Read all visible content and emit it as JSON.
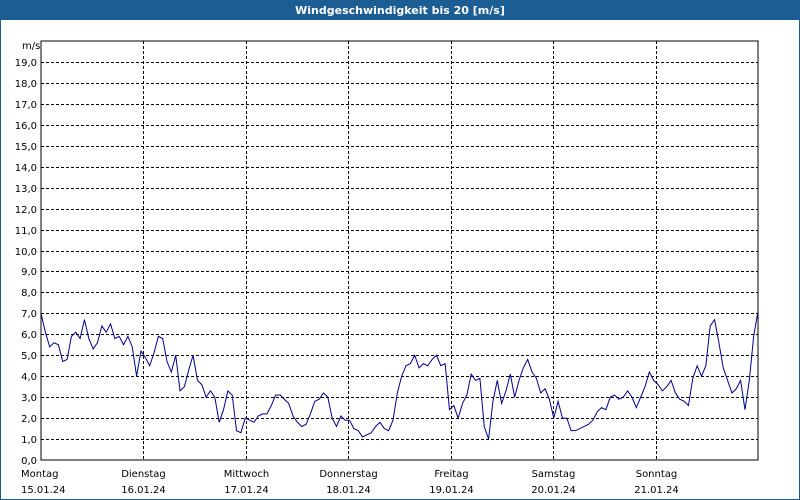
{
  "chart_data": {
    "type": "line",
    "title": "Windgeschwindigkeit bis 20 [m/s]",
    "ylabel": "m/s",
    "ylim": [
      0,
      20
    ],
    "yticks": [
      "0,0",
      "1,0",
      "2,0",
      "3,0",
      "4,0",
      "5,0",
      "6,0",
      "7,0",
      "8,0",
      "9,0",
      "10,0",
      "11,0",
      "12,0",
      "13,0",
      "14,0",
      "15,0",
      "16,0",
      "17,0",
      "18,0",
      "19,0"
    ],
    "grid": true,
    "xticks": [
      {
        "day": "Montag",
        "date": "15.01.24"
      },
      {
        "day": "Dienstag",
        "date": "16.01.24"
      },
      {
        "day": "Mittwoch",
        "date": "17.01.24"
      },
      {
        "day": "Donnerstag",
        "date": "18.01.24"
      },
      {
        "day": "Freitag",
        "date": "19.01.24"
      },
      {
        "day": "Samstag",
        "date": "20.01.24"
      },
      {
        "day": "Sonntag",
        "date": "21.01.24"
      }
    ],
    "line_color": "#00008b",
    "series": [
      {
        "values": [
          7.0,
          6.1,
          5.4,
          5.6,
          5.5,
          4.7,
          4.8,
          5.9,
          6.1,
          5.8,
          6.7,
          5.8,
          5.3,
          5.6,
          6.4,
          6.1,
          6.5,
          5.8,
          5.9,
          5.5,
          5.9,
          5.4,
          4.0,
          5.2,
          4.9,
          4.5,
          5.1,
          5.9,
          5.8,
          4.7,
          4.2,
          5.0,
          3.3,
          3.5,
          4.3,
          5.0,
          3.8,
          3.6,
          3.0,
          3.3,
          3.0,
          1.8,
          2.4,
          3.3,
          3.1,
          1.4,
          1.3,
          2.0,
          1.9,
          1.8,
          2.1,
          2.2,
          2.2,
          2.6,
          3.1,
          3.1,
          2.9,
          2.7,
          2.1,
          1.8,
          1.6,
          1.7,
          2.2,
          2.8,
          2.9,
          3.2,
          3.0,
          2.0,
          1.6,
          2.1,
          1.9,
          1.9,
          1.5,
          1.4,
          1.1,
          1.2,
          1.3,
          1.6,
          1.8,
          1.5,
          1.4,
          1.9,
          3.2,
          4.0,
          4.5,
          4.6,
          5.0,
          4.4,
          4.6,
          4.5,
          4.8,
          5.0,
          4.5,
          4.6,
          2.4,
          2.6,
          2.0,
          2.7,
          3.1,
          4.1,
          3.8,
          3.9,
          1.6,
          1.0,
          2.8,
          3.8,
          2.7,
          3.3,
          4.1,
          3.0,
          3.8,
          4.4,
          4.8,
          4.2,
          3.9,
          3.2,
          3.4,
          2.9,
          2.0,
          2.8,
          2.0,
          2.0,
          1.4,
          1.4,
          1.5,
          1.6,
          1.7,
          1.9,
          2.3,
          2.5,
          2.4,
          3.0,
          3.1,
          2.9,
          3.0,
          3.3,
          3.0,
          2.5,
          3.0,
          3.5,
          4.2,
          3.8,
          3.6,
          3.3,
          3.5,
          3.8,
          3.2,
          2.9,
          2.8,
          2.6,
          3.9,
          4.5,
          4.0,
          4.5,
          6.4,
          6.7,
          5.6,
          4.4,
          3.8,
          3.2,
          3.4,
          3.8,
          2.4,
          3.8,
          5.9,
          7.1
        ]
      }
    ]
  }
}
